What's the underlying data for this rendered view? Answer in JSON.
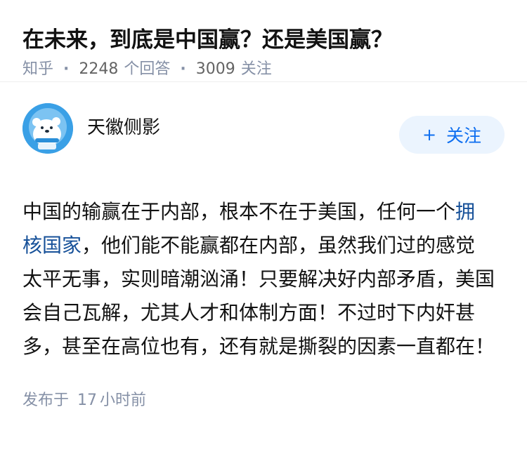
{
  "question": {
    "title": "在未来，到底是中国赢？还是美国赢？",
    "meta": {
      "source": "知乎",
      "answers_count": "2248",
      "answers_label": "个回答",
      "follow_count": "3009",
      "follow_label": "关注"
    }
  },
  "answer": {
    "author": {
      "name": "天徽侧影",
      "avatar_icon": "polar-bear-avatar-icon"
    },
    "follow_button": {
      "icon": "plus-icon",
      "label": "关注"
    },
    "body": {
      "before_link": "中国的输赢在于内部，根本不在于美国，任何一个",
      "link_text": "拥核国家",
      "after_link": "，他们能不能赢都在内部，虽然我们过的感觉太平无事，实则暗潮汹涌！只要解决好内部矛盾，美国会自己瓦解，尤其人才和体制方面！不过时下内奸甚多，甚至在高位也有，还有就是撕裂的因素一直都在！"
    },
    "time": {
      "prefix": "发布于",
      "number": "17",
      "unit": "小时前"
    }
  },
  "colors": {
    "accent": "#0d6ef0",
    "link": "#175199",
    "muted": "#8590a6",
    "follow_bg": "#ebf4fe"
  }
}
